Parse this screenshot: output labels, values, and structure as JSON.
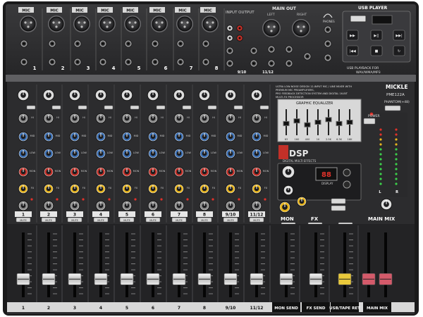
{
  "labels": {
    "mic": "MIC",
    "input_output": "INPUT  OUTPUT",
    "main_out": "MAIN OUT",
    "left": "LEFT",
    "right": "RIGHT",
    "usb_player": "USB PLAYER",
    "usb_playback": "USB PLAYBACK FOR",
    "usb_formats": "WAV/WMA/MP3",
    "brand": "MICKLE",
    "model": "PME122A",
    "blurb_1": "ULTRA LOW-NOISE DESIGN 12-INPUT MIC / LINE MIXER WITH",
    "blurb_2": "PREMIUM MIC PREAMPLIFIERS,",
    "blurb_3": "PRO FEEDBACK DETECTION SYSTEM AND DIGITAL 16-BIT",
    "blurb_4": "MULTI-FX PROCESSOR",
    "graphic_eq": "GRAPHIC EQUALIZER",
    "phantom": "PHANTOM(+48)",
    "power": "POWER",
    "dsp": "DSP",
    "dsp_sub": "DIGITAL MULTI EFFECTS",
    "display": "DISPLAY",
    "main_mix": "MAIN MIX",
    "mon": "MON",
    "fx": "FX",
    "mute": "MUTE",
    "phones": "PHONES"
  },
  "mic_numbers": [
    "1",
    "2",
    "3",
    "4",
    "5",
    "6",
    "7",
    "8"
  ],
  "channel_numbers": [
    "1",
    "2",
    "3",
    "4",
    "5",
    "6",
    "7",
    "8",
    "9/10",
    "11/12"
  ],
  "fader_labels": [
    "1",
    "2",
    "3",
    "4",
    "5",
    "6",
    "7",
    "8",
    "9/10",
    "11/12",
    "MON SEND",
    "FX SEND",
    "USB/TAPE RET",
    "MAIN MIX"
  ],
  "eq_freqs": [
    "63",
    "160",
    "400",
    "1K",
    "2.5K",
    "6.3K",
    "16K"
  ],
  "colors": {
    "panel": "#2e2e30",
    "panel_dark": "#1c1c1e",
    "knob_blue": "#3b6fb3",
    "knob_red": "#c23028",
    "knob_yellow": "#e8b51e",
    "knob_grey": "#8c8c8c",
    "led_green": "#3ccf4a",
    "led_red": "#e0322a",
    "usb_fader_cap": "#e9c93b",
    "main_fader_cap": "#d45a6a"
  }
}
